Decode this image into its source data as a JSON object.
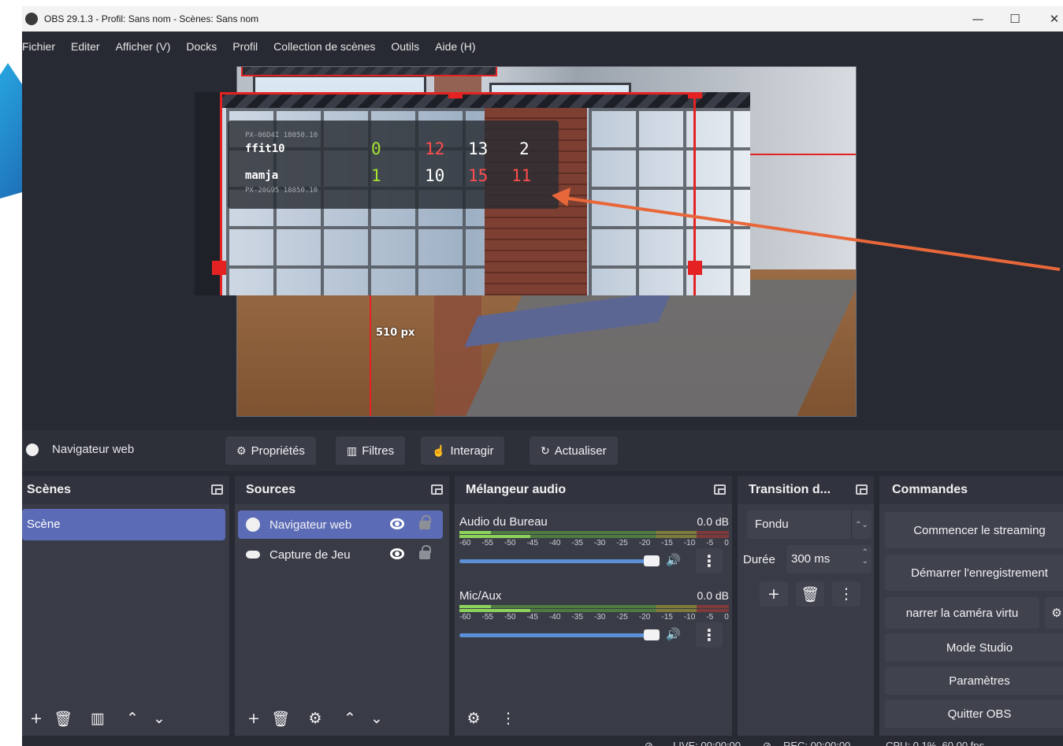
{
  "window": {
    "title": "OBS 29.1.3 - Profil: Sans nom - Scènes: Sans nom",
    "controls": {
      "minimize": "—",
      "maximize": "☐",
      "close": "✕"
    }
  },
  "menu": [
    "Fichier",
    "Editer",
    "Afficher (V)",
    "Docks",
    "Profil",
    "Collection de scènes",
    "Outils",
    "Aide (H)"
  ],
  "preview": {
    "dimension_label": "510 px"
  },
  "scoreboard": {
    "tag_top": "PX-06D4I 18050.10",
    "tag_bottom": "PX-20G95 18050.10",
    "rows": [
      {
        "name": "ffit10",
        "a": "0",
        "b": "12",
        "c": "13",
        "d": "2"
      },
      {
        "name": "mamja",
        "a": "1",
        "b": "10",
        "c": "15",
        "d": "11"
      }
    ],
    "colors": {
      "green": "#a6e22e",
      "red": "#ff4d4d",
      "white": "#ffffff"
    }
  },
  "source_bar": {
    "selected_source": "Navigateur web",
    "buttons": {
      "properties": "Propriétés",
      "filters": "Filtres",
      "interact": "Interagir",
      "refresh": "Actualiser"
    }
  },
  "scenes": {
    "title": "Scènes",
    "items": [
      "Scène"
    ]
  },
  "sources": {
    "title": "Sources",
    "items": [
      {
        "label": "Navigateur web",
        "icon": "globe-icon"
      },
      {
        "label": "Capture de Jeu",
        "icon": "gamepad-icon"
      }
    ]
  },
  "mixer": {
    "title": "Mélangeur audio",
    "scale": [
      "-60",
      "-55",
      "-50",
      "-45",
      "-40",
      "-35",
      "-30",
      "-25",
      "-20",
      "-15",
      "-10",
      "-5",
      "0"
    ],
    "channels": [
      {
        "name": "Audio du Bureau",
        "db": "0.0 dB"
      },
      {
        "name": "Mic/Aux",
        "db": "0.0 dB"
      }
    ]
  },
  "transition": {
    "title": "Transition d...",
    "type": "Fondu",
    "duration_label": "Durée",
    "duration_value": "300 ms"
  },
  "controls": {
    "title": "Commandes",
    "buttons": [
      "Commencer le streaming",
      "Démarrer l'enregistrement",
      "narrer la caméra virtu",
      "Mode Studio",
      "Paramètres",
      "Quitter OBS"
    ]
  },
  "status": {
    "live": "LIVE: 00:00:00",
    "rec": "REC: 00:00:00",
    "cpu": "CPU: 0.1%, 60.00 fps"
  },
  "colors": {
    "accent": "#5b6bb6",
    "panel": "#393c47",
    "background": "#272a33",
    "arrow": "#e8673a",
    "selection_red": "#e52222"
  }
}
